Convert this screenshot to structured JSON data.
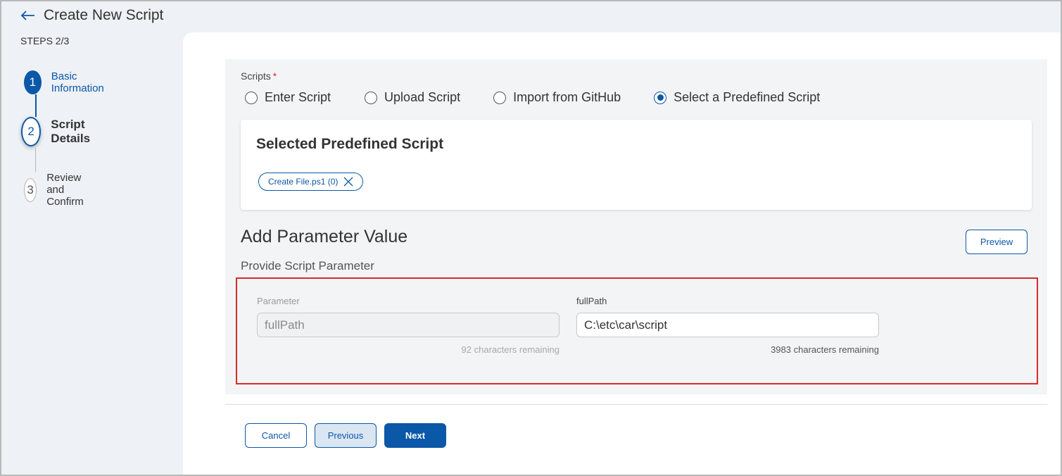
{
  "header": {
    "title": "Create New Script"
  },
  "stepper": {
    "steps_label": "STEPS 2/3",
    "steps": [
      {
        "number": "1",
        "label": "Basic Information",
        "state": "completed"
      },
      {
        "number": "2",
        "label": "Script Details",
        "state": "active"
      },
      {
        "number": "3",
        "label": "Review and Confirm",
        "state": "pending"
      }
    ]
  },
  "scripts": {
    "label": "Scripts",
    "required_mark": "*",
    "options": [
      {
        "label": "Enter Script",
        "checked": false
      },
      {
        "label": "Upload Script",
        "checked": false
      },
      {
        "label": "Import from GitHub",
        "checked": false
      },
      {
        "label": "Select a Predefined Script",
        "checked": true
      }
    ]
  },
  "selected_card": {
    "title": "Selected Predefined Script",
    "chip_label": "Create File.ps1 (0)"
  },
  "parameters": {
    "title": "Add Parameter Value",
    "subtitle": "Provide Script Parameter",
    "preview_label": "Preview",
    "name_field": {
      "label": "Parameter",
      "value": "fullPath",
      "hint": "92 characters remaining"
    },
    "value_field": {
      "label": "fullPath",
      "value": "C:\\etc\\car\\script",
      "hint": "3983 characters remaining"
    }
  },
  "footer": {
    "cancel_label": "Cancel",
    "previous_label": "Previous",
    "next_label": "Next"
  },
  "colors": {
    "primary": "#0b57a8",
    "highlight_border": "#d72b2b",
    "required": "#d32f2f"
  }
}
